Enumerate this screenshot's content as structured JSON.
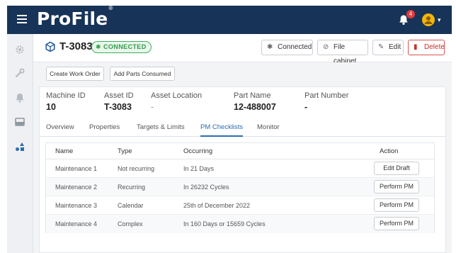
{
  "app": {
    "brand": "ProFile",
    "brand_mark": "®",
    "notification_count": "4",
    "colors": {
      "topbar": "#173357",
      "accent": "#2b6cb0",
      "connected": "#3fae5a",
      "danger": "#d9534f",
      "avatar": "#f2b705"
    }
  },
  "header": {
    "asset_title": "T-3083",
    "status_badge": "CONNECTED",
    "buttons": {
      "connected": "Connected",
      "file_cabinet": "File cabinet",
      "edit": "Edit",
      "delete": "Delete"
    }
  },
  "actions": {
    "create_work_order": "Create Work Order",
    "add_parts_consumed": "Add Parts Consumed"
  },
  "details": {
    "machine_id": {
      "label": "Machine ID",
      "value": "10"
    },
    "asset_id": {
      "label": "Asset ID",
      "value": "T-3083"
    },
    "asset_location": {
      "label": "Asset Location",
      "value": "-"
    },
    "part_name": {
      "label": "Part Name",
      "value": "12-488007"
    },
    "part_number": {
      "label": "Part Number",
      "value": "-"
    }
  },
  "tabs": {
    "overview": "Overview",
    "properties": "Properties",
    "targets_limits": "Targets & Limits",
    "pm_checklists": "PM Checklists",
    "monitor": "Monitor",
    "active": "PM Checklists"
  },
  "table": {
    "headers": {
      "name": "Name",
      "type": "Type",
      "occurring": "Occurring",
      "action": "Action"
    },
    "rows": [
      {
        "name": "Maintenance 1",
        "type": "Not recurring",
        "occurring": "In 21 Days",
        "action": "Edit Draft"
      },
      {
        "name": "Maintenance 2",
        "type": "Recurring",
        "occurring": "In 26232 Cycles",
        "action": "Perform PM"
      },
      {
        "name": "Maintenance 3",
        "type": "Calendar",
        "occurring": "25th of December 2022",
        "action": "Perform PM"
      },
      {
        "name": "Maintenance 4",
        "type": "Complex",
        "occurring": "In 160 Days or 15659 Cycles",
        "action": "Perform PM"
      }
    ]
  },
  "icons": {
    "menu": "hamburger-menu-icon",
    "bell": "bell-icon",
    "avatar": "user-avatar-icon",
    "settings": "gear-icon",
    "tools": "wrench-icon",
    "alerts": "bell-icon",
    "inventory": "inbox-icon",
    "assets": "shapes-icon",
    "cube": "cube-icon",
    "bluetooth": "bluetooth-icon",
    "paperclip": "paperclip-icon",
    "pencil": "pencil-icon",
    "trash": "trash-icon"
  }
}
